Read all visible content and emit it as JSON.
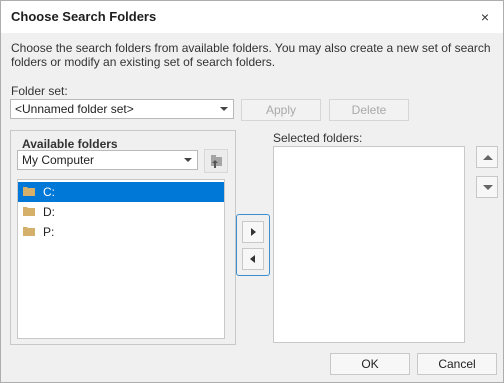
{
  "dialog": {
    "title": "Choose Search Folders",
    "close_icon": "×"
  },
  "description": "Choose the search folders from available folders. You may also create a new set of search folders or modify an existing set of search folders.",
  "folder_set": {
    "label": "Folder set:",
    "value": "<Unnamed folder set>",
    "apply_label": "Apply",
    "delete_label": "Delete"
  },
  "available": {
    "title": "Available folders",
    "location": "My Computer",
    "items": [
      {
        "label": "C:",
        "selected": true,
        "icon": "folder-icon"
      },
      {
        "label": "D:",
        "selected": false,
        "icon": "folder-icon"
      },
      {
        "label": "P:",
        "selected": false,
        "icon": "folder-icon"
      }
    ]
  },
  "selected": {
    "label": "Selected folders:",
    "items": []
  },
  "footer": {
    "ok_label": "OK",
    "cancel_label": "Cancel"
  },
  "colors": {
    "selection": "#0078d7",
    "folder": "#d4b06a",
    "focus_border": "#3b8fd0"
  }
}
